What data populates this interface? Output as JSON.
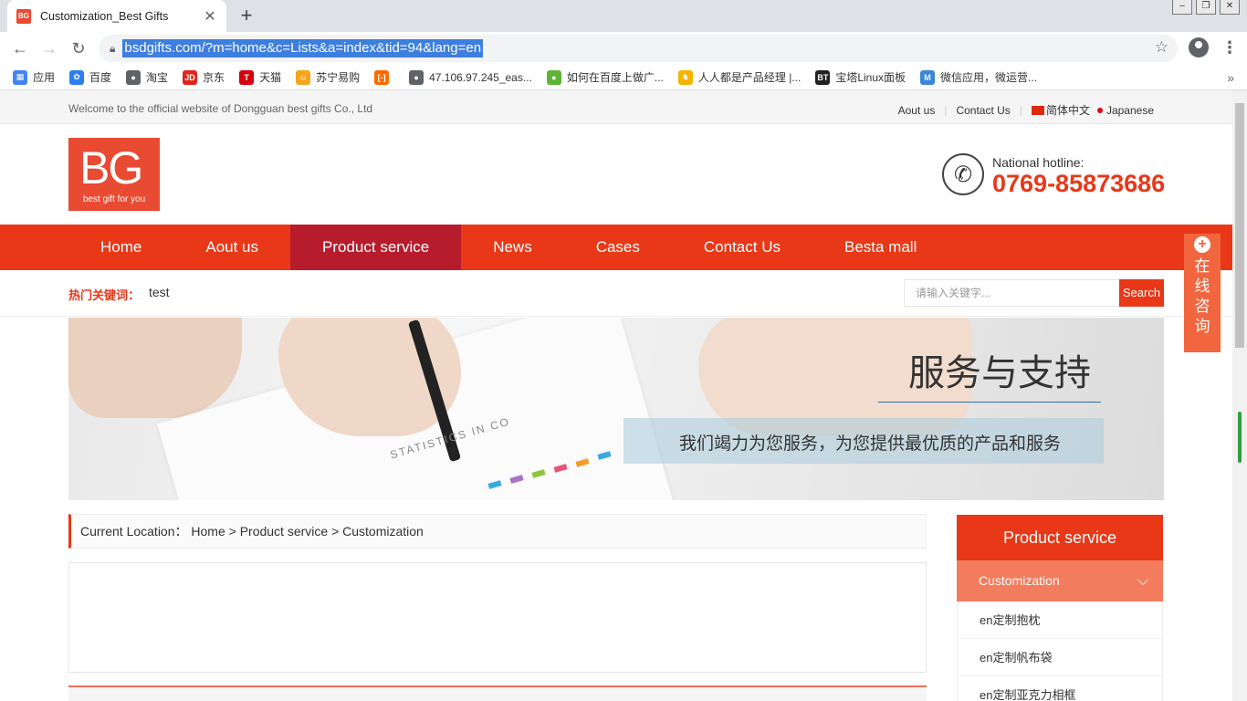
{
  "browser": {
    "tab_title": "Customization_Best Gifts",
    "tab_favicon": "BG",
    "url": "bsdgifts.com/?m=home&c=Lists&a=index&tid=94&lang=en",
    "bookmarks": [
      {
        "label": "应用",
        "icon": "apps-grid-icon",
        "color": "#4285f4",
        "glyph": "▦"
      },
      {
        "label": "百度",
        "icon": "baidu-paw-icon",
        "color": "#2d7ef0",
        "glyph": "✿"
      },
      {
        "label": "淘宝",
        "icon": "globe-icon",
        "color": "#5f6368",
        "glyph": "●"
      },
      {
        "label": "京东",
        "icon": "jd-icon",
        "color": "#e1251b",
        "glyph": "JD"
      },
      {
        "label": "天猫",
        "icon": "tmall-icon",
        "color": "#d6000f",
        "glyph": "T"
      },
      {
        "label": "苏宁易购",
        "icon": "suning-icon",
        "color": "#f7a41d",
        "glyph": "☺"
      },
      {
        "label": "",
        "icon": "aliyun-icon",
        "color": "#ff6a00",
        "glyph": "[-]"
      },
      {
        "label": "47.106.97.245_eas...",
        "icon": "globe-icon",
        "color": "#5f6368",
        "glyph": "●"
      },
      {
        "label": "如何在百度上做广...",
        "icon": "wechat-bubble-icon",
        "color": "#5fb336",
        "glyph": "●"
      },
      {
        "label": "人人都是产品经理 |...",
        "icon": "woshipm-icon",
        "color": "#f5b400",
        "glyph": "♞"
      },
      {
        "label": "宝塔Linux面板",
        "icon": "bt-icon",
        "color": "#222222",
        "glyph": "BT"
      },
      {
        "label": "微信应用，微运营...",
        "icon": "m-icon",
        "color": "#3b86d8",
        "glyph": "M"
      }
    ]
  },
  "site": {
    "welcome": "Welcome to the official website of Dongguan best gifts Co., Ltd",
    "top_links": {
      "about": "Aout us",
      "contact": "Contact Us",
      "lang_cn": "简体中文",
      "lang_jp": "Japanese"
    },
    "logo": {
      "big": "BG",
      "small": "best gift for you"
    },
    "hotline": {
      "label": "National hotline:",
      "number": "0769-85873686"
    },
    "nav": [
      {
        "label": "Home",
        "active": false
      },
      {
        "label": "Aout us",
        "active": false
      },
      {
        "label": "Product service",
        "active": true
      },
      {
        "label": "News",
        "active": false
      },
      {
        "label": "Cases",
        "active": false
      },
      {
        "label": "Contact Us",
        "active": false
      },
      {
        "label": "Besta mall",
        "active": false
      }
    ],
    "hot_keywords_label": "热门关键词：",
    "hot_keyword": "test",
    "search_placeholder": "请输入关键字...",
    "search_button": "Search",
    "banner": {
      "title": "服务与支持",
      "subtitle": "我们竭力为您服务，为您提供最优质的产品和服务",
      "paper_text": "STATISTICS IN CO"
    },
    "breadcrumb": "Current Location： Home > Product service > Customization",
    "sidebar": {
      "header": "Product service",
      "current": "Customization",
      "items": [
        "en定制抱枕",
        "en定制帆布袋",
        "en定制亚克力相框"
      ]
    },
    "float_consult": [
      "在",
      "线",
      "咨",
      "询"
    ]
  },
  "colors": {
    "brand": "#e83818",
    "nav_active": "#b71c2c",
    "accent_light": "#f47c5e"
  }
}
